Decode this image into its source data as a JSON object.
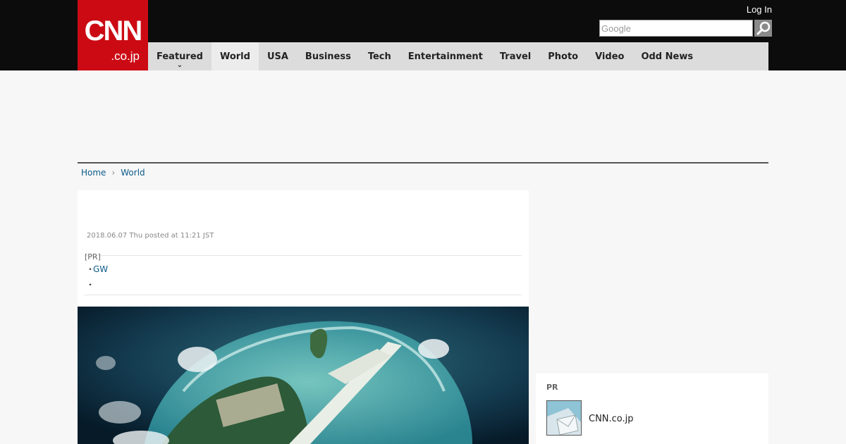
{
  "header": {
    "logo_main": "CNN",
    "logo_sub": ".co.jp",
    "login_label": "Log In",
    "search_placeholder": "Google",
    "search_icon": "magnifier-icon"
  },
  "nav": {
    "items": [
      {
        "label": "Featured"
      },
      {
        "label": "World"
      },
      {
        "label": "USA"
      },
      {
        "label": "Business"
      },
      {
        "label": "Tech"
      },
      {
        "label": "Entertainment"
      },
      {
        "label": "Travel"
      },
      {
        "label": "Photo"
      },
      {
        "label": "Video"
      },
      {
        "label": "Odd News"
      }
    ],
    "active": "World"
  },
  "breadcrumb": {
    "items": [
      "Home",
      "World"
    ],
    "separator_icon": "chevron-right-icon"
  },
  "article": {
    "posted": "2018.06.07 Thu posted at 11:21 JST",
    "pr_label": "[PR]",
    "pr_links": [
      "GW",
      ""
    ]
  },
  "sidebar": {
    "pr_title": "PR",
    "pr_item_name": "CNN.co.jp"
  },
  "colors": {
    "brand_red": "#cc0a14",
    "topbar_bg": "#0c0c0c",
    "nav_bg": "#dcdcdc",
    "link": "#0b5a8a"
  }
}
